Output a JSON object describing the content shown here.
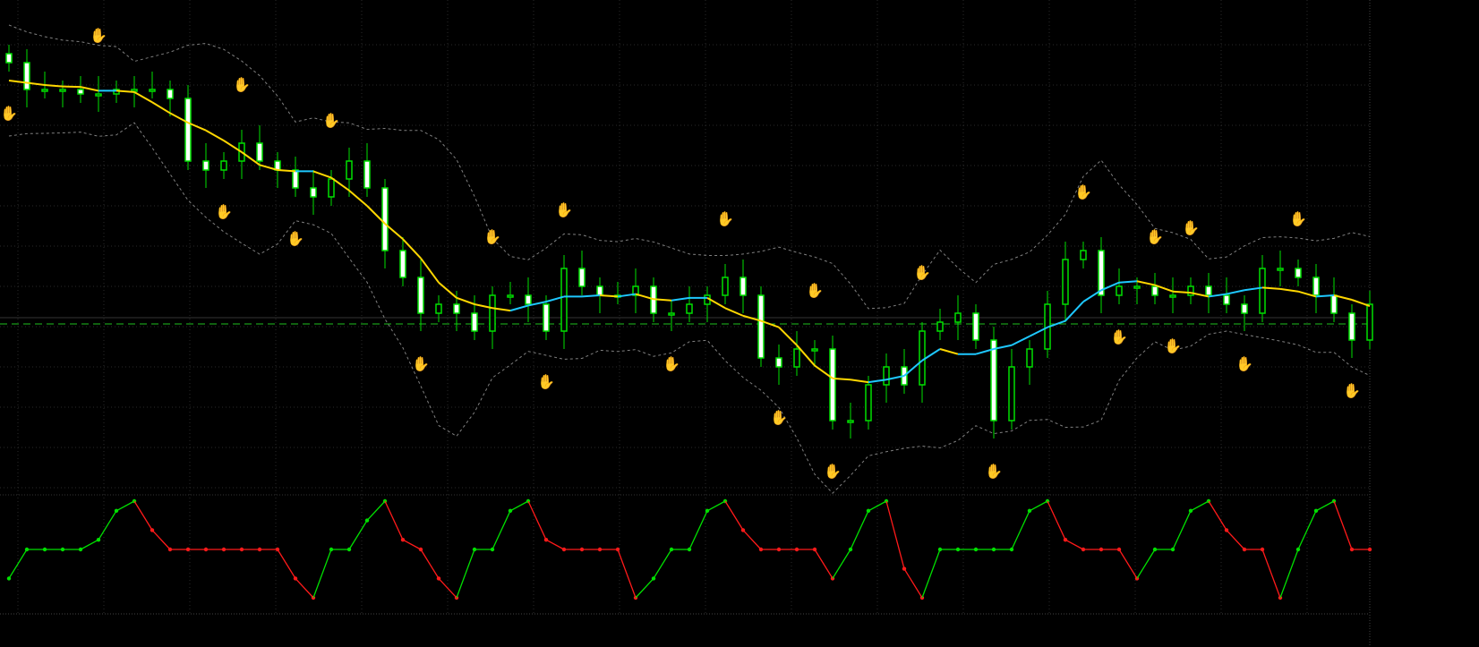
{
  "colors": {
    "background": "#000000",
    "grid": "#2a2a2a",
    "bull_candle": "#00e000",
    "bear_candle": "#ffffff",
    "ma_falling": "#ffd700",
    "ma_rising": "#1ec8ff",
    "bands": "#808080",
    "level_line": "#1fbf1f",
    "osc_up": "#00e000",
    "osc_down": "#ff1a1a",
    "signal_sell": "#e01010",
    "signal_buy": "#2a7fff"
  },
  "icons": {
    "sell_signal": "hand-icon",
    "buy_signal": "hand-icon"
  },
  "chart_data": [
    {
      "type": "candlestick",
      "title": "",
      "xlabel": "",
      "ylabel": "",
      "ylim": [
        0,
        100
      ],
      "grid": true,
      "closes": [
        94,
        88,
        88,
        88,
        87,
        87,
        88,
        88,
        88,
        86,
        72,
        70,
        72,
        76,
        72,
        70,
        66,
        64,
        68,
        72,
        66,
        52,
        46,
        38,
        40,
        38,
        34,
        42,
        42,
        40,
        34,
        48,
        44,
        42,
        42,
        44,
        38,
        38,
        40,
        42,
        46,
        42,
        28,
        26,
        30,
        30,
        14,
        14,
        22,
        26,
        22,
        34,
        36,
        38,
        32,
        14,
        26,
        30,
        40,
        50,
        52,
        42,
        44,
        44,
        42,
        42,
        44,
        42,
        40,
        38,
        48,
        48,
        46,
        42,
        38,
        32,
        40
      ],
      "level_line": 35.6,
      "signals": [
        {
          "i": 5,
          "type": "sell"
        },
        {
          "i": 13,
          "type": "sell"
        },
        {
          "i": 18,
          "type": "sell"
        },
        {
          "i": 27,
          "type": "sell"
        },
        {
          "i": 31,
          "type": "sell"
        },
        {
          "i": 40,
          "type": "sell"
        },
        {
          "i": 45,
          "type": "sell"
        },
        {
          "i": 51,
          "type": "sell"
        },
        {
          "i": 60,
          "type": "sell"
        },
        {
          "i": 64,
          "type": "sell"
        },
        {
          "i": 66,
          "type": "sell"
        },
        {
          "i": 72,
          "type": "sell"
        },
        {
          "i": 0,
          "type": "buy"
        },
        {
          "i": 12,
          "type": "buy"
        },
        {
          "i": 16,
          "type": "buy"
        },
        {
          "i": 23,
          "type": "buy"
        },
        {
          "i": 30,
          "type": "buy"
        },
        {
          "i": 37,
          "type": "buy"
        },
        {
          "i": 43,
          "type": "buy"
        },
        {
          "i": 46,
          "type": "buy"
        },
        {
          "i": 55,
          "type": "buy"
        },
        {
          "i": 62,
          "type": "buy"
        },
        {
          "i": 65,
          "type": "buy"
        },
        {
          "i": 69,
          "type": "buy"
        },
        {
          "i": 75,
          "type": "buy"
        }
      ]
    },
    {
      "type": "line",
      "title": "",
      "ylim": [
        0,
        100
      ],
      "values": [
        20,
        50,
        50,
        50,
        50,
        60,
        90,
        100,
        70,
        50,
        50,
        50,
        50,
        50,
        50,
        50,
        20,
        0,
        50,
        50,
        80,
        100,
        60,
        50,
        20,
        0,
        50,
        50,
        90,
        100,
        60,
        50,
        50,
        50,
        50,
        0,
        20,
        50,
        50,
        90,
        100,
        70,
        50,
        50,
        50,
        50,
        20,
        50,
        90,
        100,
        30,
        0,
        50,
        50,
        50,
        50,
        50,
        90,
        100,
        60,
        50,
        50,
        50,
        20,
        50,
        50,
        90,
        100,
        70,
        50,
        50,
        0,
        50,
        90,
        100,
        50,
        50
      ]
    }
  ]
}
